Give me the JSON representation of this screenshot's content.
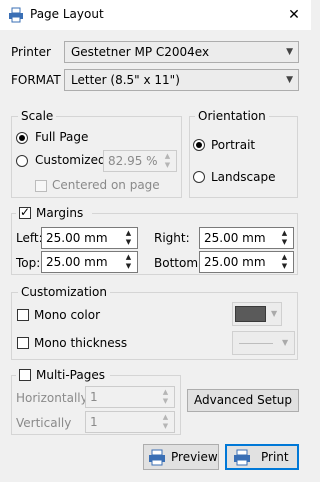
{
  "window": {
    "title": "Page Layout",
    "close_glyph": "✕"
  },
  "printer": {
    "label": "Printer",
    "value": "Gestetner MP C2004ex"
  },
  "format": {
    "label": "FORMAT",
    "value": "Letter (8.5\" x 11\")"
  },
  "scale": {
    "group_label": "Scale",
    "full_page_label": "Full Page",
    "customized_label": "Customized",
    "customized_value": "82.95 %",
    "centered_label": "Centered on page",
    "selected": "Full Page"
  },
  "orientation": {
    "group_label": "Orientation",
    "portrait_label": "Portrait",
    "landscape_label": "Landscape",
    "selected": "Portrait"
  },
  "margins": {
    "label": "Margins",
    "checked": true,
    "left_label": "Left:",
    "left_value": "25.00 mm",
    "right_label": "Right:",
    "right_value": "25.00 mm",
    "top_label": "Top:",
    "top_value": "25.00 mm",
    "bottom_label": "Bottom:",
    "bottom_value": "25.00 mm"
  },
  "customization": {
    "group_label": "Customization",
    "mono_color_label": "Mono color",
    "mono_thickness_label": "Mono thickness",
    "color_swatch": "#5a5a5a"
  },
  "multipages": {
    "label": "Multi-Pages",
    "horizontally_label": "Horizontally",
    "horizontally_value": "1",
    "vertically_label": "Vertically",
    "vertically_value": "1"
  },
  "buttons": {
    "advanced_setup": "Advanced Setup",
    "preview": "Preview",
    "print": "Print"
  },
  "icons": {
    "title": "printer-settings-icon",
    "preview": "printer-preview-icon",
    "print": "printer-icon"
  },
  "colors": {
    "accent": "#0078d7",
    "icon_blue": "#3a6fb5"
  }
}
